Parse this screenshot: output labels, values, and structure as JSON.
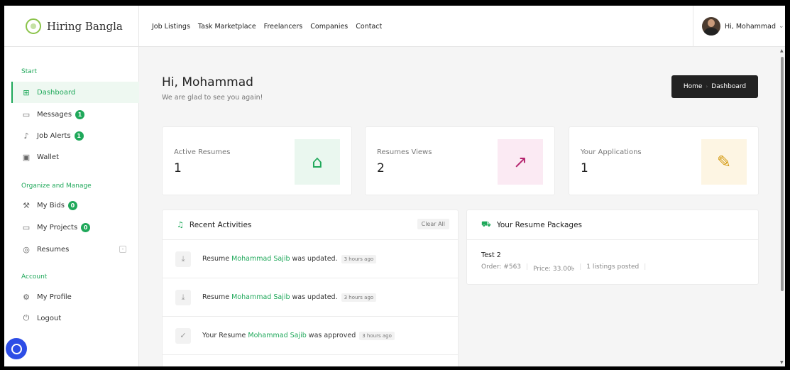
{
  "brand": {
    "name": "Hiring Bangla"
  },
  "nav": [
    "Job Listings",
    "Task Marketplace",
    "Freelancers",
    "Companies",
    "Contact"
  ],
  "user": {
    "greeting": "Hi, Mohammad"
  },
  "sidebar": {
    "sections": [
      "Start",
      "Organize and Manage",
      "Account"
    ],
    "items": [
      {
        "label": "Dashboard",
        "icon": "dashboard-icon",
        "active": true
      },
      {
        "label": "Messages",
        "icon": "messages-icon",
        "badge": "1"
      },
      {
        "label": "Job Alerts",
        "icon": "bell-icon",
        "badge": "1"
      },
      {
        "label": "Wallet",
        "icon": "wallet-icon"
      },
      {
        "label": "My Bids",
        "icon": "gavel-icon",
        "badge": "0"
      },
      {
        "label": "My Projects",
        "icon": "folder-icon",
        "badge": "0"
      },
      {
        "label": "Resumes",
        "icon": "resume-icon"
      },
      {
        "label": "My Profile",
        "icon": "settings-icon"
      },
      {
        "label": "Logout",
        "icon": "power-icon"
      }
    ]
  },
  "header": {
    "title": "Hi, Mohammad",
    "subtitle": "We are glad to see you again!",
    "breadcrumb": [
      "Home",
      "Dashboard"
    ]
  },
  "stats": [
    {
      "label": "Active Resumes",
      "value": "1",
      "icon": "briefcase-icon",
      "color": "#1fa85a",
      "bg": "#eaf7ef"
    },
    {
      "label": "Resumes Views",
      "value": "2",
      "icon": "trending-up-icon",
      "color": "#b5246e",
      "bg": "#fbeaf3"
    },
    {
      "label": "Your Applications",
      "value": "1",
      "icon": "message-edit-icon",
      "color": "#d49a12",
      "bg": "#fdf5e3"
    }
  ],
  "activities": {
    "title": "Recent Activities",
    "clear": "Clear All",
    "items": [
      {
        "pre": "Resume",
        "name": "Mohammad Sajib",
        "post": "was updated.",
        "time": "3 hours ago"
      },
      {
        "pre": "Resume",
        "name": "Mohammad Sajib",
        "post": "was updated.",
        "time": "3 hours ago"
      },
      {
        "pre": "Your Resume",
        "name": "Mohammad Sajib",
        "post": "was approved",
        "time": "3 hours ago"
      }
    ]
  },
  "packages": {
    "title": "Your Resume Packages",
    "item": {
      "name": "Test 2",
      "order": "Order: #563",
      "price": "Price: 33.00৳",
      "listings": "1 listings posted"
    }
  },
  "colors": {
    "accent": "#1fa85a"
  }
}
